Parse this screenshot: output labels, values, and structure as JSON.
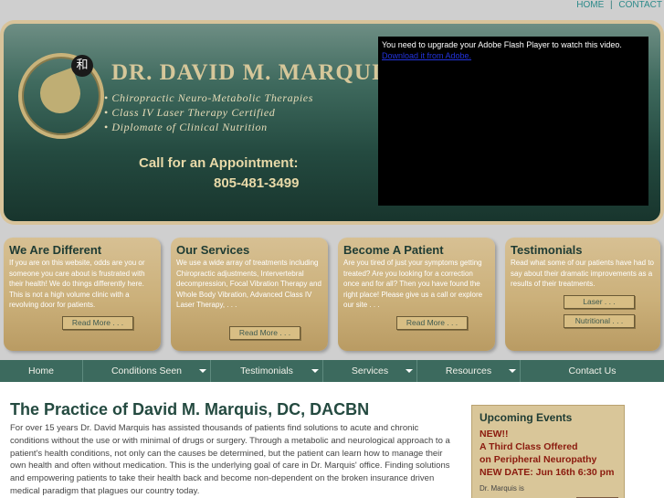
{
  "top_links": {
    "home": "HOME",
    "separator": "|",
    "contact": "CONTACT"
  },
  "header": {
    "doctor_name": "DR. DAVID M. MARQUIS",
    "logo_seal": "和",
    "credentials": [
      "Chiropractic Neuro-Metabolic Therapies",
      "Class IV Laser Therapy Certified",
      "Diplomate of Clinical Nutrition"
    ],
    "call_label": "Call for an Appointment:",
    "phone": "805-481-3499",
    "flash_message": "You need to upgrade your Adobe Flash Player to watch this video.",
    "flash_link": "Download it from Adobe."
  },
  "features": [
    {
      "title": "We Are Different",
      "text": "If you are on this website, odds are you or someone you care about is frustrated with their health! We do things differently here. This is not a high volume clinic with a revolving door for patients.",
      "buttons": [
        "Read More . . ."
      ]
    },
    {
      "title": "Our Services",
      "text": "We use a wide array of treatments including Chiropractic adjustments, Intervertebral decompression, Focal Vibration Therapy and Whole Body Vibration, Advanced Class IV Laser Therapy, . . .",
      "buttons": [
        "Read More . . ."
      ]
    },
    {
      "title": "Become A Patient",
      "text": "Are you tired of just your symptoms getting treated? Are you looking for a correction once and for all? Then you have found the right place! Please give us a call or explore our site . . .",
      "buttons": [
        "Read More . . ."
      ]
    },
    {
      "title": "Testimonials",
      "text": "Read what some of our patients have had to say about their dramatic improvements as a results of their treatments.",
      "buttons": [
        "Laser . . .",
        "Nutritional . . ."
      ]
    }
  ],
  "nav": [
    {
      "label": "Home",
      "dropdown": false
    },
    {
      "label": "Conditions Seen",
      "dropdown": true
    },
    {
      "label": "Testimonials",
      "dropdown": true
    },
    {
      "label": "Services",
      "dropdown": true
    },
    {
      "label": "Resources",
      "dropdown": true
    },
    {
      "label": "Contact Us",
      "dropdown": false
    }
  ],
  "main": {
    "title": "The Practice of David M. Marquis, DC, DACBN",
    "text": "For over 15 years Dr. David Marquis has assisted thousands of patients find solutions to acute and chronic conditions without the use or with minimal of drugs or surgery. Through a metabolic and neurological approach to a patient's health conditions, not only can the causes be determined, but the patient can learn how to manage their own health and often without medication. This is the underlying goal of care in Dr. Marquis' office. Finding solutions and empowering patients to take their health back and become non-dependent on the broken insurance driven medical paradigm that plagues our country today."
  },
  "events": {
    "title": "Upcoming Events",
    "lines": [
      "NEW!!",
      "A Third Class Offered",
      "on Peripheral Neuropathy",
      "NEW DATE: Jun 16th 6:30 pm"
    ],
    "footer_text": "Dr. Marquis is"
  },
  "colors": {
    "nav_bg": "#3c6a5e",
    "title_green": "#244a40",
    "event_red": "#8b1a0e",
    "box_tan": "#cbb07a"
  }
}
